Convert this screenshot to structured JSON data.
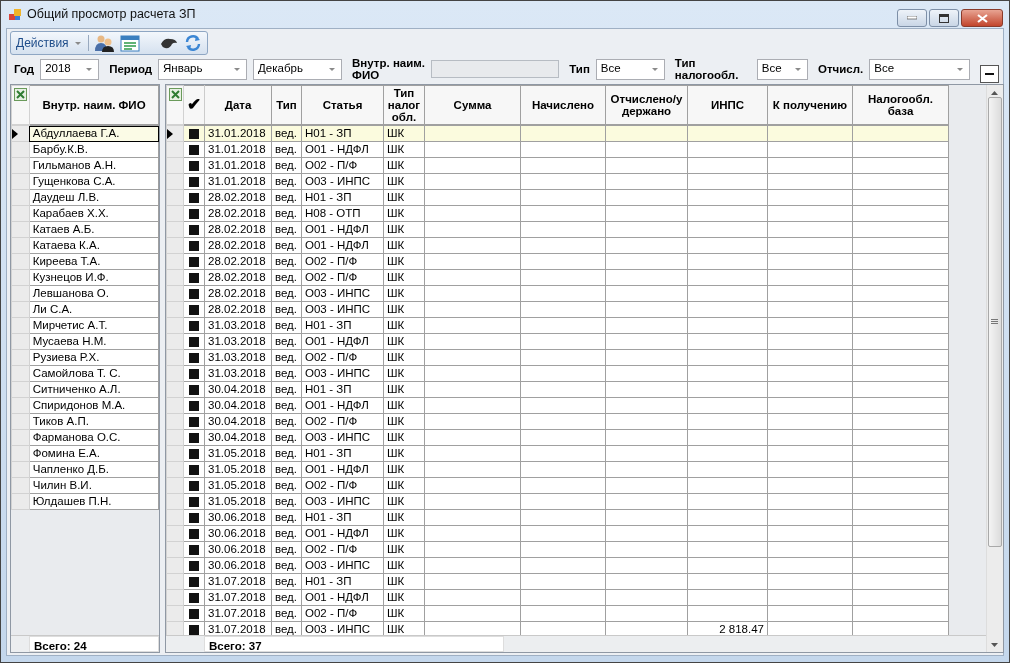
{
  "window": {
    "title": "Общий просмотр расчета ЗП"
  },
  "toolbar": {
    "actions_label": "Действия"
  },
  "filters": [
    {
      "label": "Год",
      "controls": [
        {
          "kind": "combo",
          "value": "2018"
        }
      ]
    },
    {
      "label": "Период",
      "controls": [
        {
          "kind": "combo",
          "value": "Январь"
        },
        {
          "kind": "combo",
          "value": "Декабрь"
        }
      ]
    },
    {
      "label": "Внутр. наим. ФИО",
      "controls": [
        {
          "kind": "text",
          "disabled": true
        }
      ]
    },
    {
      "label": "Тип",
      "controls": [
        {
          "kind": "combo",
          "value": "Все"
        }
      ]
    },
    {
      "label": "Тип налогообл.",
      "controls": [
        {
          "kind": "combo",
          "value": "Все"
        }
      ]
    },
    {
      "label": "Отчисл.",
      "controls": [
        {
          "kind": "combo",
          "value": "Все"
        }
      ]
    }
  ],
  "employees": {
    "column": "Внутр. наим. ФИО",
    "footer": "Всего: 24",
    "rows": [
      {
        "name": "Абдуллаева Г.А.",
        "selected": true
      },
      {
        "name": "Барбу.К.В.",
        "selected": false
      },
      {
        "name": "Гильманов А.Н.",
        "selected": false
      },
      {
        "name": "Гущенкова С.А.",
        "selected": false
      },
      {
        "name": "Даудеш Л.В.",
        "selected": false
      },
      {
        "name": "Карабаев Х.Х.",
        "selected": false
      },
      {
        "name": "Катаев А.Б.",
        "selected": false
      },
      {
        "name": "Катаева К.А.",
        "selected": false
      },
      {
        "name": "Киреева Т.А.",
        "selected": false
      },
      {
        "name": "Кузнецов И.Ф.",
        "selected": false
      },
      {
        "name": "Левшанова О.",
        "selected": false
      },
      {
        "name": "Ли С.А.",
        "selected": false
      },
      {
        "name": "Мирчетис А.Т.",
        "selected": false
      },
      {
        "name": "Мусаева Н.М.",
        "selected": false
      },
      {
        "name": "Рузиева Р.Х.",
        "selected": false
      },
      {
        "name": "Самойлова Т. С.",
        "selected": false
      },
      {
        "name": "Ситниченко А.Л.",
        "selected": false
      },
      {
        "name": "Спиридонов М.А.",
        "selected": false
      },
      {
        "name": "Тиков А.П.",
        "selected": false
      },
      {
        "name": "Фарманова О.С.",
        "selected": false
      },
      {
        "name": "Фомина Е.А.",
        "selected": false
      },
      {
        "name": "Чапленко Д.Б.",
        "selected": false
      },
      {
        "name": "Чилин В.И.",
        "selected": false
      },
      {
        "name": "Юлдашев П.Н.",
        "selected": false
      }
    ]
  },
  "payments": {
    "columns": [
      "✔",
      "Дата",
      "Тип",
      "Статья",
      "Тип налог обл.",
      "Сумма",
      "Начислено",
      "Отчислено/удержано",
      "ИНПС",
      "К получению",
      "Налогообл. база"
    ],
    "footer": "Всего: 37",
    "rows": [
      {
        "selected": true,
        "checked": true,
        "date": "31.01.2018",
        "type": "вед.",
        "article": "Н01 - ЗП",
        "tax_type": "ШК"
      },
      {
        "selected": false,
        "checked": true,
        "date": "31.01.2018",
        "type": "вед.",
        "article": "О01 - НДФЛ",
        "tax_type": "ШК"
      },
      {
        "selected": false,
        "checked": true,
        "date": "31.01.2018",
        "type": "вед.",
        "article": "О02 - П/Ф",
        "tax_type": "ШК"
      },
      {
        "selected": false,
        "checked": true,
        "date": "31.01.2018",
        "type": "вед.",
        "article": "О03 - ИНПС",
        "tax_type": "ШК"
      },
      {
        "selected": false,
        "checked": true,
        "date": "28.02.2018",
        "type": "вед.",
        "article": "Н01 - ЗП",
        "tax_type": "ШК"
      },
      {
        "selected": false,
        "checked": true,
        "date": "28.02.2018",
        "type": "вед.",
        "article": "Н08 - ОТП",
        "tax_type": "ШК"
      },
      {
        "selected": false,
        "checked": true,
        "date": "28.02.2018",
        "type": "вед.",
        "article": "О01 - НДФЛ",
        "tax_type": "ШК"
      },
      {
        "selected": false,
        "checked": true,
        "date": "28.02.2018",
        "type": "вед.",
        "article": "О01 - НДФЛ",
        "tax_type": "ШК"
      },
      {
        "selected": false,
        "checked": true,
        "date": "28.02.2018",
        "type": "вед.",
        "article": "О02 - П/Ф",
        "tax_type": "ШК"
      },
      {
        "selected": false,
        "checked": true,
        "date": "28.02.2018",
        "type": "вед.",
        "article": "О02 - П/Ф",
        "tax_type": "ШК"
      },
      {
        "selected": false,
        "checked": true,
        "date": "28.02.2018",
        "type": "вед.",
        "article": "О03 - ИНПС",
        "tax_type": "ШК"
      },
      {
        "selected": false,
        "checked": true,
        "date": "28.02.2018",
        "type": "вед.",
        "article": "О03 - ИНПС",
        "tax_type": "ШК"
      },
      {
        "selected": false,
        "checked": true,
        "date": "31.03.2018",
        "type": "вед.",
        "article": "Н01 - ЗП",
        "tax_type": "ШК"
      },
      {
        "selected": false,
        "checked": true,
        "date": "31.03.2018",
        "type": "вед.",
        "article": "О01 - НДФЛ",
        "tax_type": "ШК"
      },
      {
        "selected": false,
        "checked": true,
        "date": "31.03.2018",
        "type": "вед.",
        "article": "О02 - П/Ф",
        "tax_type": "ШК"
      },
      {
        "selected": false,
        "checked": true,
        "date": "31.03.2018",
        "type": "вед.",
        "article": "О03 - ИНПС",
        "tax_type": "ШК"
      },
      {
        "selected": false,
        "checked": true,
        "date": "30.04.2018",
        "type": "вед.",
        "article": "Н01 - ЗП",
        "tax_type": "ШК"
      },
      {
        "selected": false,
        "checked": true,
        "date": "30.04.2018",
        "type": "вед.",
        "article": "О01 - НДФЛ",
        "tax_type": "ШК"
      },
      {
        "selected": false,
        "checked": true,
        "date": "30.04.2018",
        "type": "вед.",
        "article": "О02 - П/Ф",
        "tax_type": "ШК"
      },
      {
        "selected": false,
        "checked": true,
        "date": "30.04.2018",
        "type": "вед.",
        "article": "О03 - ИНПС",
        "tax_type": "ШК"
      },
      {
        "selected": false,
        "checked": true,
        "date": "31.05.2018",
        "type": "вед.",
        "article": "Н01 - ЗП",
        "tax_type": "ШК"
      },
      {
        "selected": false,
        "checked": true,
        "date": "31.05.2018",
        "type": "вед.",
        "article": "О01 - НДФЛ",
        "tax_type": "ШК"
      },
      {
        "selected": false,
        "checked": true,
        "date": "31.05.2018",
        "type": "вед.",
        "article": "О02 - П/Ф",
        "tax_type": "ШК"
      },
      {
        "selected": false,
        "checked": true,
        "date": "31.05.2018",
        "type": "вед.",
        "article": "О03 - ИНПС",
        "tax_type": "ШК"
      },
      {
        "selected": false,
        "checked": true,
        "date": "30.06.2018",
        "type": "вед.",
        "article": "Н01 - ЗП",
        "tax_type": "ШК"
      },
      {
        "selected": false,
        "checked": true,
        "date": "30.06.2018",
        "type": "вед.",
        "article": "О01 - НДФЛ",
        "tax_type": "ШК"
      },
      {
        "selected": false,
        "checked": true,
        "date": "30.06.2018",
        "type": "вед.",
        "article": "О02 - П/Ф",
        "tax_type": "ШК"
      },
      {
        "selected": false,
        "checked": true,
        "date": "30.06.2018",
        "type": "вед.",
        "article": "О03 - ИНПС",
        "tax_type": "ШК"
      },
      {
        "selected": false,
        "checked": true,
        "date": "31.07.2018",
        "type": "вед.",
        "article": "Н01 - ЗП",
        "tax_type": "ШК"
      },
      {
        "selected": false,
        "checked": true,
        "date": "31.07.2018",
        "type": "вед.",
        "article": "О01 - НДФЛ",
        "tax_type": "ШК"
      },
      {
        "selected": false,
        "checked": true,
        "date": "31.07.2018",
        "type": "вед.",
        "article": "О02 - П/Ф",
        "tax_type": "ШК"
      },
      {
        "selected": false,
        "checked": true,
        "date": "31.07.2018",
        "type": "вед.",
        "article": "О03 - ИНПС",
        "tax_type": "ШК",
        "inps": "2 818.47"
      }
    ]
  }
}
